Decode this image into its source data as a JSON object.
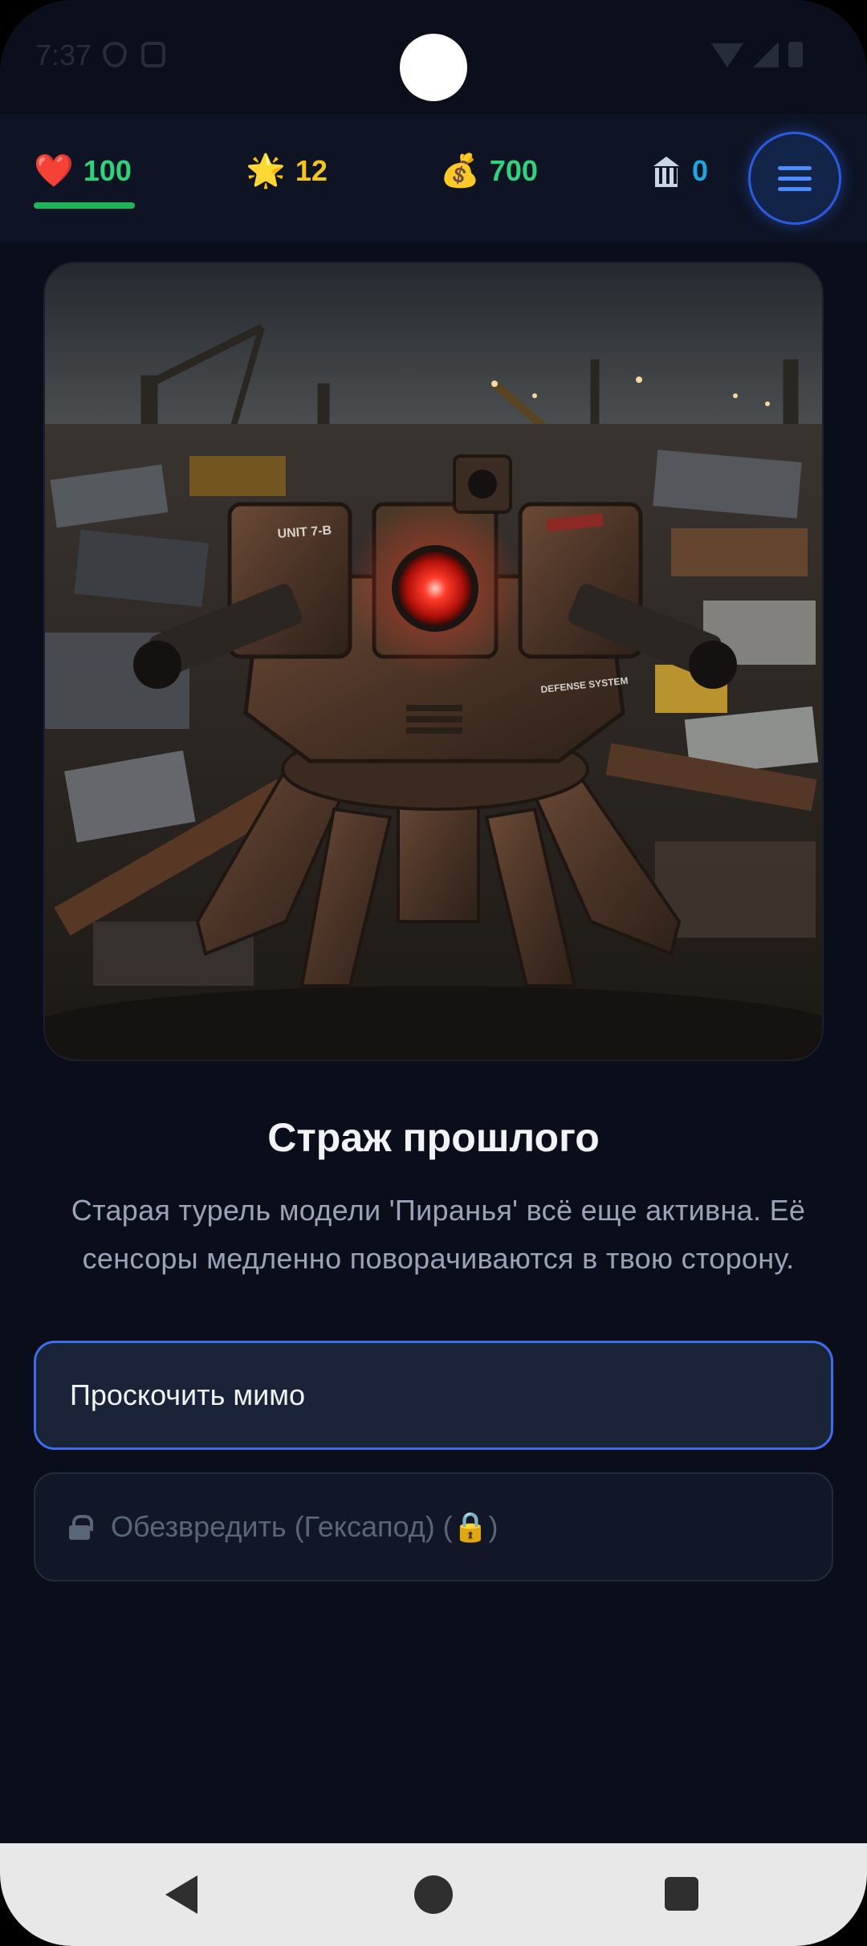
{
  "status_bar": {
    "time": "7:37"
  },
  "hud": {
    "health": {
      "icon": "heart-icon",
      "value": "100",
      "fill_fraction": 1.0
    },
    "stars": {
      "icon": "star-icon",
      "value": "12"
    },
    "money": {
      "icon": "money-bag-icon",
      "value": "700"
    },
    "bank": {
      "icon": "bank-icon",
      "value": "0"
    },
    "menu": {
      "icon": "hamburger-menu-icon"
    }
  },
  "scene": {
    "image": "rusty-turret-in-junkyard",
    "labels": {
      "unit": "UNIT 7-B",
      "defense": "DEFENSE SYSTEM"
    }
  },
  "event": {
    "title": "Страж прошлого",
    "description": "Старая турель модели 'Пиранья' всё еще активна. Её сенсоры медленно поворачиваются в твою сторону."
  },
  "choices": [
    {
      "label": "Проскочить мимо",
      "locked": false
    },
    {
      "label": "Обезвредить (Гексапод) (🔒)",
      "locked": true
    }
  ],
  "colors": {
    "background": "#0a0e1a",
    "accent": "#3d6eea",
    "health": "#2fd47a",
    "stars": "#f5c518",
    "money": "#33d17a",
    "bank": "#1fa6e0"
  }
}
